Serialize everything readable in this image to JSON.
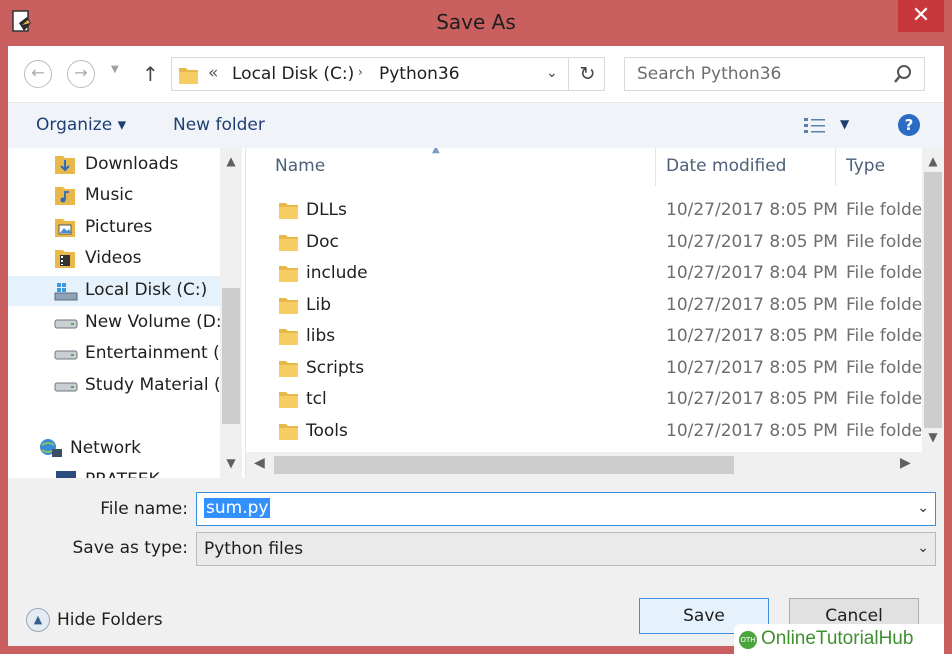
{
  "window": {
    "title": "Save As",
    "close_glyph": "✕"
  },
  "nav": {
    "back_glyph": "←",
    "forward_glyph": "→",
    "recent_glyph": "▼",
    "up_glyph": "↑",
    "address": {
      "prefix": "«",
      "crumb1": "Local Disk (C:)",
      "separator": "›",
      "crumb2": "Python36",
      "dropdown": "⌄",
      "refresh_glyph": "↻"
    },
    "search_placeholder": "Search Python36"
  },
  "toolbar": {
    "organize": "Organize ▾",
    "new_folder": "New folder",
    "view_dropdown": "▼",
    "help": "?"
  },
  "sidebar": {
    "items": [
      {
        "label": "Downloads",
        "icon": "downloads-folder-icon"
      },
      {
        "label": "Music",
        "icon": "music-folder-icon"
      },
      {
        "label": "Pictures",
        "icon": "pictures-folder-icon"
      },
      {
        "label": "Videos",
        "icon": "videos-folder-icon"
      },
      {
        "label": "Local Disk (C:)",
        "icon": "drive-icon",
        "selected": true
      },
      {
        "label": "New Volume (D:)",
        "icon": "drive-icon"
      },
      {
        "label": "Entertainment (E",
        "icon": "drive-icon"
      },
      {
        "label": "Study Material (F",
        "icon": "drive-icon"
      },
      {
        "label": "Network",
        "icon": "network-icon"
      },
      {
        "label": "PRATEEK",
        "icon": "computer-icon"
      }
    ],
    "scroll_up": "▲",
    "scroll_down": "▼"
  },
  "files": {
    "columns": {
      "name": "Name",
      "date": "Date modified",
      "type": "Type",
      "sort_glyph": "▲"
    },
    "rows": [
      {
        "name": "DLLs",
        "date": "10/27/2017 8:05 PM",
        "type": "File folde"
      },
      {
        "name": "Doc",
        "date": "10/27/2017 8:05 PM",
        "type": "File folde"
      },
      {
        "name": "include",
        "date": "10/27/2017 8:04 PM",
        "type": "File folde"
      },
      {
        "name": "Lib",
        "date": "10/27/2017 8:05 PM",
        "type": "File folde"
      },
      {
        "name": "libs",
        "date": "10/27/2017 8:05 PM",
        "type": "File folde"
      },
      {
        "name": "Scripts",
        "date": "10/27/2017 8:05 PM",
        "type": "File folde"
      },
      {
        "name": "tcl",
        "date": "10/27/2017 8:05 PM",
        "type": "File folde"
      },
      {
        "name": "Tools",
        "date": "10/27/2017 8:05 PM",
        "type": "File folde"
      }
    ],
    "scroll_left": "◀",
    "scroll_right": "▶",
    "scroll_up": "▲",
    "scroll_down": "▼"
  },
  "form": {
    "filename_label": "File name:",
    "filename_value": "sum.py",
    "type_label": "Save as type:",
    "type_value": "Python files",
    "dropdown": "⌄"
  },
  "footer": {
    "hide_folders": "Hide Folders",
    "hide_glyph": "▲",
    "save": "Save",
    "cancel": "Cancel"
  },
  "watermark": {
    "text": "OnlineTutorialHub",
    "logo": "OTH"
  },
  "colors": {
    "titlebar": "#c9605f",
    "close": "#c8383a",
    "accent": "#3390ff",
    "link": "#1f3f73",
    "folder": "#e8b94a"
  }
}
